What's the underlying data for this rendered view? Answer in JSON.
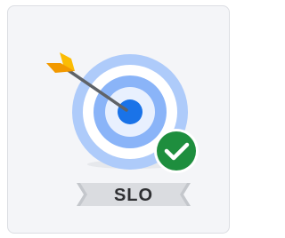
{
  "tile": {
    "label": "SLO",
    "icons": {
      "target": "target-icon",
      "arrow": "arrow-icon",
      "check": "check-badge-icon",
      "ribbon": "ribbon-banner"
    },
    "colors": {
      "card_background": "#f4f5f8",
      "card_border": "#dcdee3",
      "ring_outer": "#aecbfa",
      "ring_white": "#ffffff",
      "ring_middle": "#8ab4f8",
      "ring_inner": "#e8f0fe",
      "bullseye": "#1a73e8",
      "arrow_shaft": "#5f6368",
      "fletching_light": "#fbbc04",
      "fletching_dark": "#f29900",
      "check_badge": "#1e8e3e",
      "check_mark": "#ffffff",
      "ribbon": "#dadce0",
      "ribbon_fold": "#c4c7cc",
      "label_text": "#2f3033"
    }
  }
}
